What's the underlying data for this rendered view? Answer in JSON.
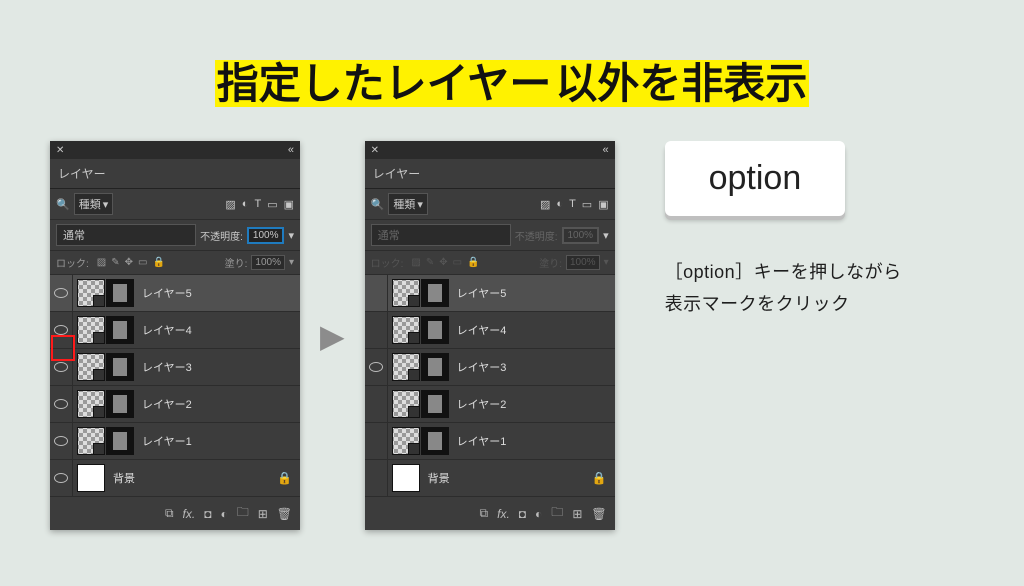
{
  "title_span": "指定したレイヤー",
  "title_rest": "以外を非表示",
  "key_label": "option",
  "instruction_line1": "［option］キーを押しながら",
  "instruction_line2": "表示マークをクリック",
  "panel": {
    "tab_title": "レイヤー",
    "filter_label": "種類",
    "blend_mode": "通常",
    "opacity_label": "不透明度:",
    "opacity_value": "100%",
    "lock_label": "ロック:",
    "fill_label": "塗り:",
    "fill_value": "100%"
  },
  "layers_before": [
    {
      "name": "レイヤー5",
      "eye": true,
      "selected": true,
      "smart": true,
      "mask": true
    },
    {
      "name": "レイヤー4",
      "eye": true,
      "selected": false,
      "smart": true,
      "mask": true
    },
    {
      "name": "レイヤー3",
      "eye": true,
      "selected": false,
      "smart": true,
      "mask": true,
      "highlight_eye": true
    },
    {
      "name": "レイヤー2",
      "eye": true,
      "selected": false,
      "smart": true,
      "mask": true
    },
    {
      "name": "レイヤー1",
      "eye": true,
      "selected": false,
      "smart": true,
      "mask": true
    },
    {
      "name": "背景",
      "eye": true,
      "selected": false,
      "smart": false,
      "mask": false,
      "white": true,
      "locked": true
    }
  ],
  "layers_after": [
    {
      "name": "レイヤー5",
      "eye": false,
      "selected": true,
      "smart": true,
      "mask": true
    },
    {
      "name": "レイヤー4",
      "eye": false,
      "selected": false,
      "smart": true,
      "mask": true
    },
    {
      "name": "レイヤー3",
      "eye": true,
      "selected": false,
      "smart": true,
      "mask": true
    },
    {
      "name": "レイヤー2",
      "eye": false,
      "selected": false,
      "smart": true,
      "mask": true
    },
    {
      "name": "レイヤー1",
      "eye": false,
      "selected": false,
      "smart": true,
      "mask": true
    },
    {
      "name": "背景",
      "eye": false,
      "selected": false,
      "smart": false,
      "mask": false,
      "white": true,
      "locked": true
    }
  ],
  "filter_icons": [
    "image-icon",
    "adjust-icon",
    "type-icon",
    "shape-icon",
    "smartobj-icon"
  ],
  "bottom_icons": [
    "link-icon",
    "fx-icon",
    "mask-icon",
    "adjustment-icon",
    "group-icon",
    "new-icon",
    "trash-icon"
  ]
}
